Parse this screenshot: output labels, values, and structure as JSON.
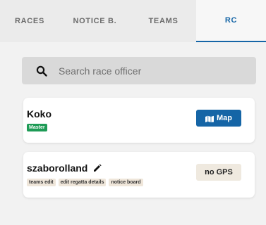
{
  "tabs": [
    {
      "label": "RACES"
    },
    {
      "label": "NOTICE B."
    },
    {
      "label": "TEAMS"
    },
    {
      "label": "RC"
    }
  ],
  "active_tab": "RC",
  "search": {
    "placeholder": "Search race officer",
    "value": "",
    "icon": "search-icon"
  },
  "officers": [
    {
      "name": "Koko",
      "badges": [
        "Master"
      ],
      "action_label": "Map",
      "action_icon": "map-icon"
    },
    {
      "name": "szaborolland",
      "edit_icon": "pencil-icon",
      "badges": [
        "teams edit",
        "edit regatta details",
        "notice board"
      ],
      "status_label": "no GPS"
    }
  ],
  "colors": {
    "accent": "#1565a6",
    "master_badge": "#1e9b56",
    "permission_badge": "#efe6da"
  }
}
